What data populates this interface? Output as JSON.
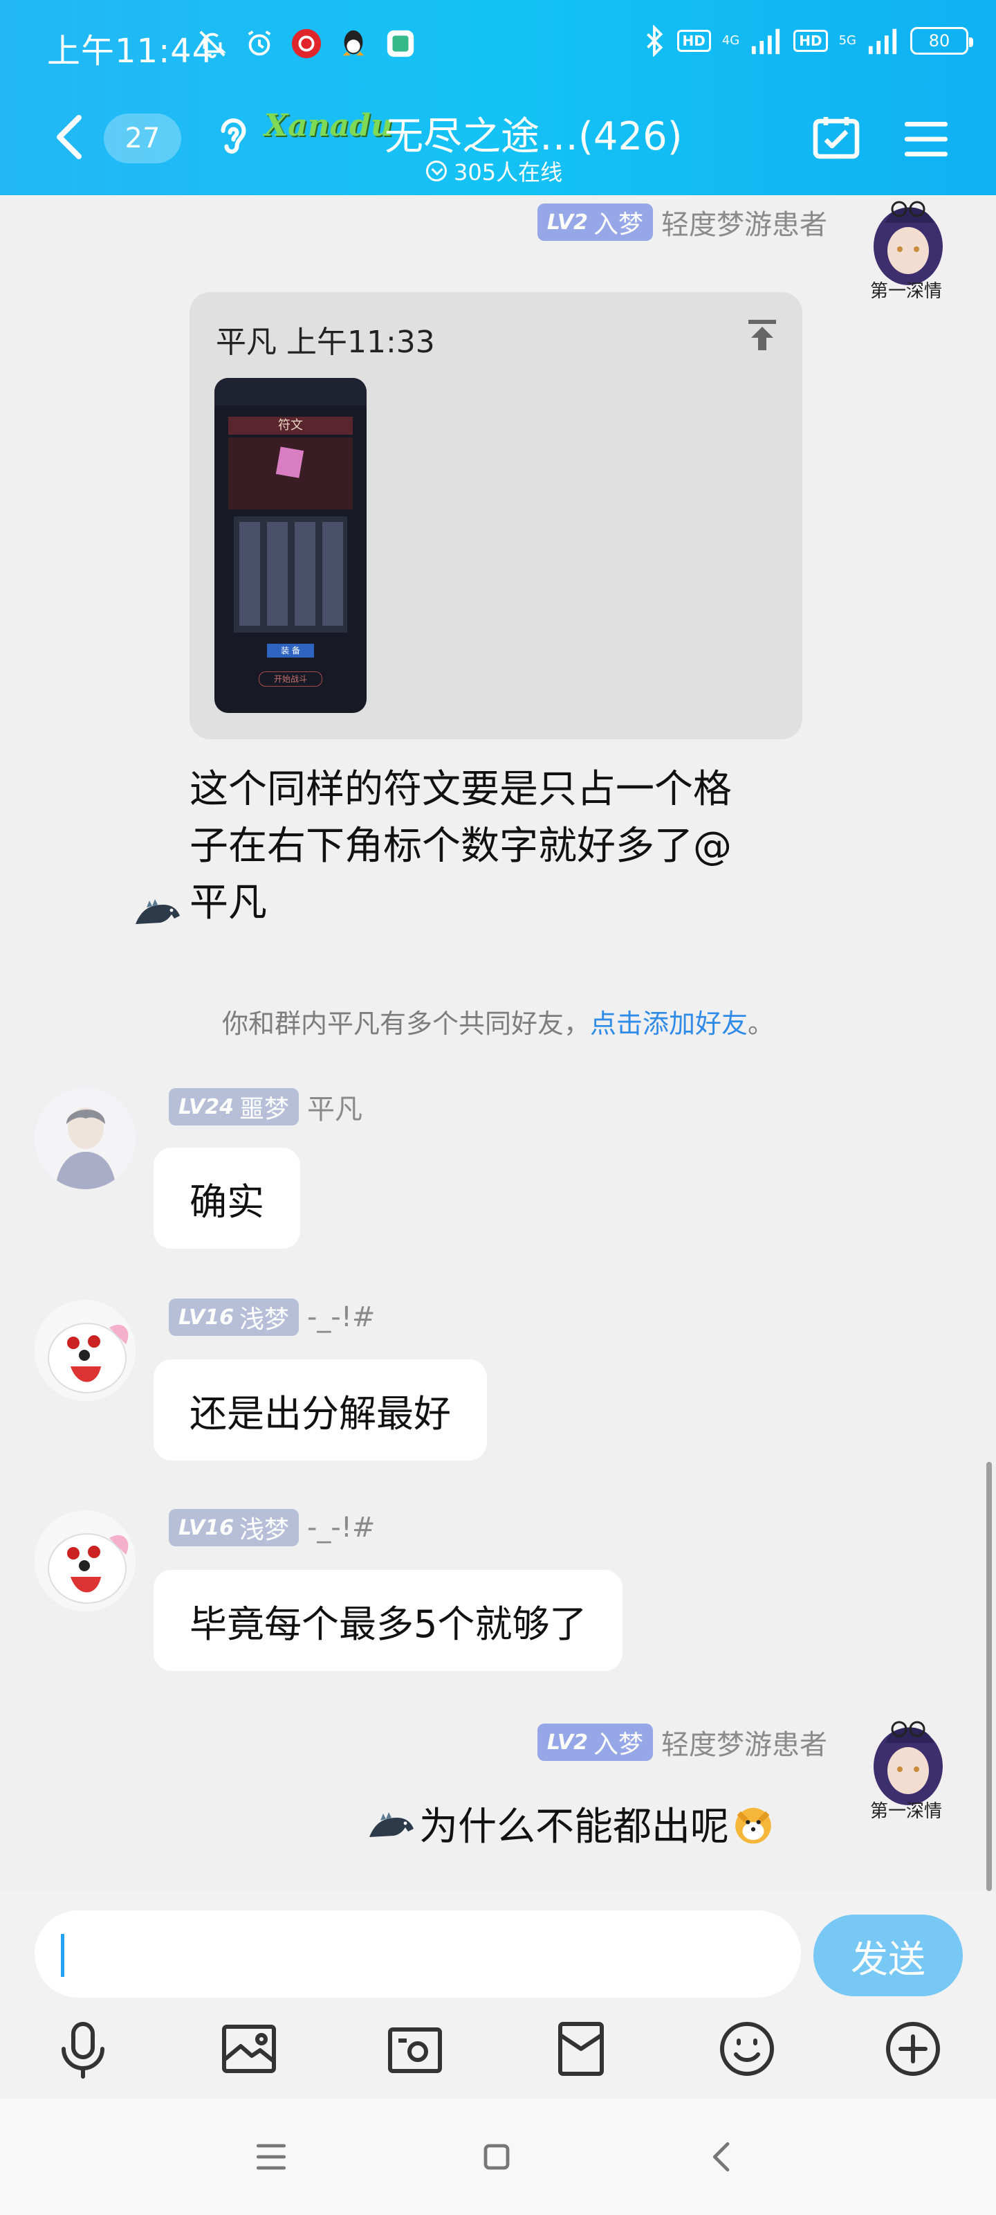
{
  "status_bar": {
    "time": "上午11:44",
    "net1": "4G",
    "net2": "5G",
    "hd": "HD",
    "battery": "80"
  },
  "header": {
    "unread_count": "27",
    "logo_text": "Xanadu",
    "group_name": "无尽之途…(426)",
    "online": "305人在线"
  },
  "messages": [
    {
      "id": "m1",
      "sender_level": "LV2",
      "sender_rank": "入梦",
      "sender_name": "轻度梦游患者",
      "reply": {
        "meta": "平凡 上午11:33",
        "thumb_title": "符文",
        "thumb_button": "装 备",
        "thumb_footer": "开始战斗"
      },
      "text_lines": [
        "这个同样的符文要是只占一个格",
        "子在右下角标个数字就好多了@",
        "平凡"
      ]
    },
    {
      "id": "sys",
      "note": "你和群内平凡有多个共同好友，",
      "link": "点击添加好友",
      "end": "。"
    },
    {
      "id": "m2",
      "sender_level": "LV24",
      "sender_rank": "噩梦",
      "sender_name": "平凡",
      "text": "确实"
    },
    {
      "id": "m3",
      "sender_level": "LV16",
      "sender_rank": "浅梦",
      "sender_name": "-_-!#",
      "text": "还是出分解最好"
    },
    {
      "id": "m4",
      "sender_level": "LV16",
      "sender_rank": "浅梦",
      "sender_name": "-_-!#",
      "text": "毕竟每个最多5个就够了"
    },
    {
      "id": "m5",
      "sender_level": "LV2",
      "sender_rank": "入梦",
      "sender_name": "轻度梦游患者",
      "text": "为什么不能都出呢"
    }
  ],
  "avatar_text": "第一深情",
  "input": {
    "placeholder": "",
    "send_label": "发送"
  },
  "icons": [
    "mic-icon",
    "image-icon",
    "camera-icon",
    "red-packet-icon",
    "emoji-icon",
    "plus-icon"
  ],
  "colors": {
    "header": "#17bdf5",
    "send": "#78c8f6",
    "link": "#2f8be8",
    "level_badge": "#b7bfd8"
  }
}
